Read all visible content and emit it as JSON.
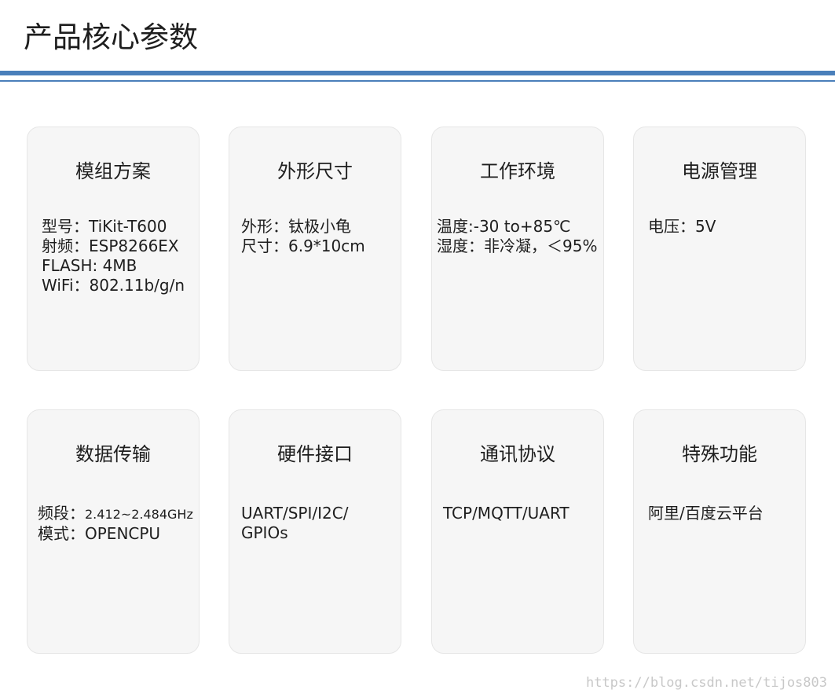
{
  "page": {
    "title": "产品核心参数",
    "accent_color": "#4a7fba",
    "card_background": "#f6f6f6"
  },
  "cards": [
    {
      "title": "模组方案",
      "lines": [
        "型号：TiKit-T600",
        "射频：ESP8266EX",
        "FLASH: 4MB",
        "WiFi：802.11b/g/n"
      ]
    },
    {
      "title": "外形尺寸",
      "lines": [
        "外形：钛极小龟",
        "尺寸：6.9*10cm"
      ]
    },
    {
      "title": "工作环境",
      "lines": [
        "温度:-30 to+85℃",
        "湿度：非冷凝，＜95%"
      ]
    },
    {
      "title": "电源管理",
      "lines": [
        "电压：5V"
      ]
    },
    {
      "title": "数据传输",
      "lines": [],
      "freq_label": "频段：",
      "freq_value": "2.412~2.484GHz",
      "mode_line": "模式：OPENCPU"
    },
    {
      "title": "硬件接口",
      "lines": [
        "UART/SPI/I2C/",
        "GPIOs"
      ]
    },
    {
      "title": "通讯协议",
      "lines": [
        "TCP/MQTT/UART"
      ]
    },
    {
      "title": "特殊功能",
      "lines": [
        "阿里/百度云平台"
      ]
    }
  ],
  "watermark": "https://blog.csdn.net/tijos803"
}
